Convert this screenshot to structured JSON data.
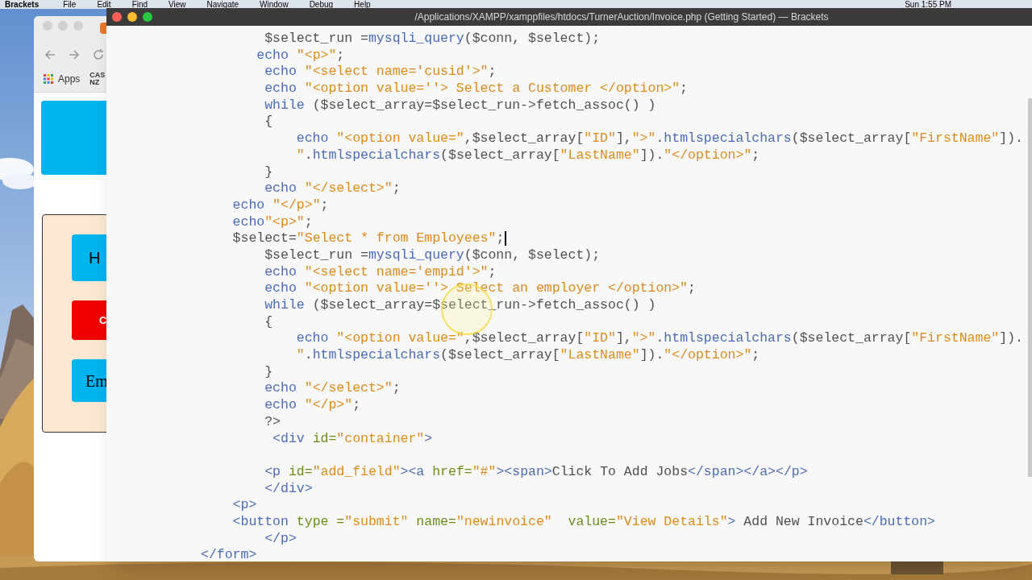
{
  "menu_bar": {
    "app": "Brackets",
    "menus": [
      "File",
      "Edit",
      "Find",
      "View",
      "Navigate",
      "Window",
      "Debug",
      "Help"
    ],
    "clock": "Sun 1:55 PM"
  },
  "browser_window": {
    "bookmarks": [
      {
        "label": "Apps",
        "kind": "apps"
      },
      {
        "label": "CAS NZ",
        "kind": "site"
      }
    ],
    "nav_buttons": [
      {
        "label": "H",
        "kind": "primary"
      },
      {
        "label": "C",
        "kind": "danger"
      },
      {
        "label": "Em",
        "kind": "serif"
      }
    ]
  },
  "editor": {
    "title": "/Applications/XAMPP/xamppfiles/htdocs/TurnerAuction/Invoice.php (Getting Started) — Brackets",
    "lines": [
      {
        "kind": "code",
        "cursor": false,
        "tokens": [
          {
            "kind": "plain",
            "text": "        $select_run ="
          },
          {
            "kind": "keyword",
            "text": "mysqli_query"
          },
          {
            "kind": "plain",
            "text": "($conn, $select);"
          }
        ]
      },
      {
        "kind": "code",
        "cursor": false,
        "tokens": [
          {
            "kind": "keyword",
            "text": "       echo"
          },
          {
            "kind": "string",
            "text": " \"<p>\""
          },
          {
            "kind": "plain",
            "text": ";"
          }
        ]
      },
      {
        "kind": "code",
        "cursor": false,
        "tokens": [
          {
            "kind": "keyword",
            "text": "        echo"
          },
          {
            "kind": "string",
            "text": " \"<select name='cusid'>\""
          },
          {
            "kind": "plain",
            "text": ";"
          }
        ]
      },
      {
        "kind": "code",
        "cursor": false,
        "tokens": [
          {
            "kind": "keyword",
            "text": "        echo"
          },
          {
            "kind": "string",
            "text": " \"<option value=''> Select a Customer </option>\""
          },
          {
            "kind": "plain",
            "text": ";"
          }
        ]
      },
      {
        "kind": "code",
        "cursor": false,
        "tokens": [
          {
            "kind": "keyword",
            "text": "        while"
          },
          {
            "kind": "plain",
            "text": " ($select_array=$select_run->fetch_assoc() )"
          }
        ]
      },
      {
        "kind": "code",
        "cursor": false,
        "tokens": [
          {
            "kind": "plain",
            "text": "        {"
          }
        ]
      },
      {
        "kind": "code",
        "cursor": false,
        "tokens": [
          {
            "kind": "keyword",
            "text": "            echo"
          },
          {
            "kind": "string",
            "text": " \"<option value=\""
          },
          {
            "kind": "plain",
            "text": ",$select_array["
          },
          {
            "kind": "string",
            "text": "\"ID\""
          },
          {
            "kind": "plain",
            "text": "],"
          },
          {
            "kind": "string",
            "text": "\">\""
          },
          {
            "kind": "plain",
            "text": "."
          },
          {
            "kind": "keyword",
            "text": "htmlspecialchars"
          },
          {
            "kind": "plain",
            "text": "($select_array["
          },
          {
            "kind": "string",
            "text": "\"FirstName\""
          },
          {
            "kind": "plain",
            "text": "])."
          }
        ]
      },
      {
        "kind": "code",
        "cursor": false,
        "tokens": [
          {
            "kind": "string",
            "text": "            \""
          },
          {
            "kind": "plain",
            "text": "."
          },
          {
            "kind": "keyword",
            "text": "htmlspecialchars"
          },
          {
            "kind": "plain",
            "text": "($select_array["
          },
          {
            "kind": "string",
            "text": "\"LastName\""
          },
          {
            "kind": "plain",
            "text": "])."
          },
          {
            "kind": "string",
            "text": "\"</option>\""
          },
          {
            "kind": "plain",
            "text": ";"
          }
        ]
      },
      {
        "kind": "code",
        "cursor": false,
        "tokens": [
          {
            "kind": "plain",
            "text": "        }"
          }
        ]
      },
      {
        "kind": "code",
        "cursor": false,
        "tokens": [
          {
            "kind": "keyword",
            "text": "        echo"
          },
          {
            "kind": "string",
            "text": " \"</select>\""
          },
          {
            "kind": "plain",
            "text": ";"
          }
        ]
      },
      {
        "kind": "code",
        "cursor": false,
        "tokens": [
          {
            "kind": "keyword",
            "text": "    echo"
          },
          {
            "kind": "string",
            "text": " \"</p>\""
          },
          {
            "kind": "plain",
            "text": ";"
          }
        ]
      },
      {
        "kind": "code",
        "cursor": false,
        "tokens": [
          {
            "kind": "keyword",
            "text": "    echo"
          },
          {
            "kind": "string",
            "text": "\"<p>\""
          },
          {
            "kind": "plain",
            "text": ";"
          }
        ]
      },
      {
        "kind": "code",
        "cursor": true,
        "tokens": [
          {
            "kind": "plain",
            "text": "    $select="
          },
          {
            "kind": "string",
            "text": "\"Select * from Employees\""
          },
          {
            "kind": "plain",
            "text": ";"
          }
        ]
      },
      {
        "kind": "code",
        "cursor": false,
        "tokens": [
          {
            "kind": "plain",
            "text": "        $select_run ="
          },
          {
            "kind": "keyword",
            "text": "mysqli_query"
          },
          {
            "kind": "plain",
            "text": "($conn, $select);"
          }
        ]
      },
      {
        "kind": "code",
        "cursor": false,
        "tokens": [
          {
            "kind": "keyword",
            "text": "        echo"
          },
          {
            "kind": "string",
            "text": " \"<select name='empid'>\""
          },
          {
            "kind": "plain",
            "text": ";"
          }
        ]
      },
      {
        "kind": "code",
        "cursor": false,
        "tokens": [
          {
            "kind": "keyword",
            "text": "        echo"
          },
          {
            "kind": "string",
            "text": " \"<option value=''> Select an employer </option>\""
          },
          {
            "kind": "plain",
            "text": ";"
          }
        ]
      },
      {
        "kind": "code",
        "cursor": false,
        "tokens": [
          {
            "kind": "keyword",
            "text": "        while"
          },
          {
            "kind": "plain",
            "text": " ($select_array=$select_run->fetch_assoc() )"
          }
        ]
      },
      {
        "kind": "code",
        "cursor": false,
        "tokens": [
          {
            "kind": "plain",
            "text": "        {"
          }
        ]
      },
      {
        "kind": "code",
        "cursor": false,
        "tokens": [
          {
            "kind": "keyword",
            "text": "            echo"
          },
          {
            "kind": "string",
            "text": " \"<option value=\""
          },
          {
            "kind": "plain",
            "text": ",$select_array["
          },
          {
            "kind": "string",
            "text": "\"ID\""
          },
          {
            "kind": "plain",
            "text": "],"
          },
          {
            "kind": "string",
            "text": "\">\""
          },
          {
            "kind": "plain",
            "text": "."
          },
          {
            "kind": "keyword",
            "text": "htmlspecialchars"
          },
          {
            "kind": "plain",
            "text": "($select_array["
          },
          {
            "kind": "string",
            "text": "\"FirstName\""
          },
          {
            "kind": "plain",
            "text": "])."
          }
        ]
      },
      {
        "kind": "code",
        "cursor": false,
        "tokens": [
          {
            "kind": "string",
            "text": "            \""
          },
          {
            "kind": "plain",
            "text": "."
          },
          {
            "kind": "keyword",
            "text": "htmlspecialchars"
          },
          {
            "kind": "plain",
            "text": "($select_array["
          },
          {
            "kind": "string",
            "text": "\"LastName\""
          },
          {
            "kind": "plain",
            "text": "])."
          },
          {
            "kind": "string",
            "text": "\"</option>\""
          },
          {
            "kind": "plain",
            "text": ";"
          }
        ]
      },
      {
        "kind": "code",
        "cursor": false,
        "tokens": [
          {
            "kind": "plain",
            "text": "        }"
          }
        ]
      },
      {
        "kind": "code",
        "cursor": false,
        "tokens": [
          {
            "kind": "keyword",
            "text": "        echo"
          },
          {
            "kind": "string",
            "text": " \"</select>\""
          },
          {
            "kind": "plain",
            "text": ";"
          }
        ]
      },
      {
        "kind": "code",
        "cursor": false,
        "tokens": [
          {
            "kind": "keyword",
            "text": "        echo"
          },
          {
            "kind": "string",
            "text": " \"</p>\""
          },
          {
            "kind": "plain",
            "text": ";"
          }
        ]
      },
      {
        "kind": "code",
        "cursor": false,
        "tokens": [
          {
            "kind": "plain",
            "text": "        ?>"
          }
        ]
      },
      {
        "kind": "code",
        "cursor": false,
        "tokens": [
          {
            "kind": "keyword",
            "text": "         <div"
          },
          {
            "kind": "attr",
            "text": " id="
          },
          {
            "kind": "string",
            "text": "\"container\""
          },
          {
            "kind": "keyword",
            "text": ">"
          }
        ]
      },
      {
        "kind": "blank",
        "cursor": false
      },
      {
        "kind": "code",
        "cursor": false,
        "tokens": [
          {
            "kind": "keyword",
            "text": "        <p"
          },
          {
            "kind": "attr",
            "text": " id="
          },
          {
            "kind": "string",
            "text": "\"add_field\""
          },
          {
            "kind": "keyword",
            "text": "><a"
          },
          {
            "kind": "attr",
            "text": " href="
          },
          {
            "kind": "string",
            "text": "\"#\""
          },
          {
            "kind": "keyword",
            "text": "><span>"
          },
          {
            "kind": "plain",
            "text": "Click To Add Jobs"
          },
          {
            "kind": "keyword",
            "text": "</span></a></p>"
          }
        ]
      },
      {
        "kind": "code",
        "cursor": false,
        "tokens": [
          {
            "kind": "keyword",
            "text": "        </div>"
          }
        ]
      },
      {
        "kind": "code",
        "cursor": false,
        "tokens": [
          {
            "kind": "keyword",
            "text": "    <p>"
          }
        ]
      },
      {
        "kind": "code",
        "cursor": false,
        "tokens": [
          {
            "kind": "keyword",
            "text": "    <button"
          },
          {
            "kind": "attr",
            "text": " type ="
          },
          {
            "kind": "string",
            "text": "\"submit\""
          },
          {
            "kind": "attr",
            "text": " name="
          },
          {
            "kind": "string",
            "text": "\"newinvoice\""
          },
          {
            "kind": "attr",
            "text": "  value="
          },
          {
            "kind": "string",
            "text": "\"View Details\""
          },
          {
            "kind": "keyword",
            "text": ">"
          },
          {
            "kind": "plain",
            "text": " Add New Invoice"
          },
          {
            "kind": "keyword",
            "text": "</button>"
          }
        ]
      },
      {
        "kind": "code",
        "cursor": false,
        "tokens": [
          {
            "kind": "keyword",
            "text": "        </p>"
          }
        ]
      },
      {
        "kind": "code",
        "cursor": false,
        "tokens": [
          {
            "kind": "keyword",
            "text": "</form>"
          }
        ]
      }
    ]
  }
}
